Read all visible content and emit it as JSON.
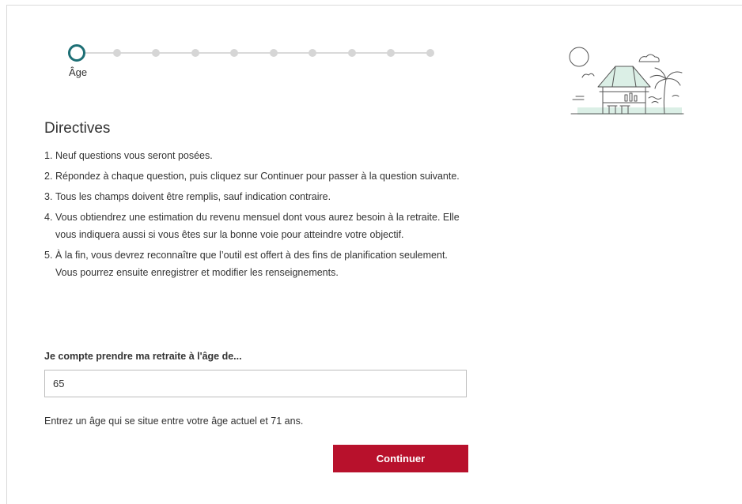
{
  "stepper": {
    "total_steps": 10,
    "current_step": 1,
    "current_label": "Âge",
    "active_color": "#1d6f75",
    "inactive_color": "#d6d6d6"
  },
  "illustration": {
    "icon": "beach-hut-palm-sun-icon"
  },
  "directives": {
    "title": "Directives",
    "items": [
      {
        "num": "1.",
        "text": "Neuf questions vous seront posées."
      },
      {
        "num": "2.",
        "text": "Répondez à chaque question, puis cliquez sur Continuer pour passer à la question suivante."
      },
      {
        "num": "3.",
        "text": "Tous les champs doivent être remplis, sauf indication contraire."
      },
      {
        "num": "4.",
        "text": "Vous obtiendrez une estimation du revenu mensuel dont vous aurez besoin à la retraite. Elle vous indiquera aussi si vous êtes sur la bonne voie pour atteindre votre objectif."
      },
      {
        "num": "5.",
        "text": "À la fin, vous devrez reconnaître que l’outil est offert à des fins de planification seulement. Vous pourrez ensuite enregistrer et modifier les renseignements."
      }
    ]
  },
  "form": {
    "retirement_age_label": "Je compte prendre ma retraite à l'âge de...",
    "retirement_age_value": "65",
    "hint": "Entrez un âge qui se situe entre votre âge actuel et 71 ans.",
    "continue_label": "Continuer",
    "button_color": "#b8112c"
  }
}
